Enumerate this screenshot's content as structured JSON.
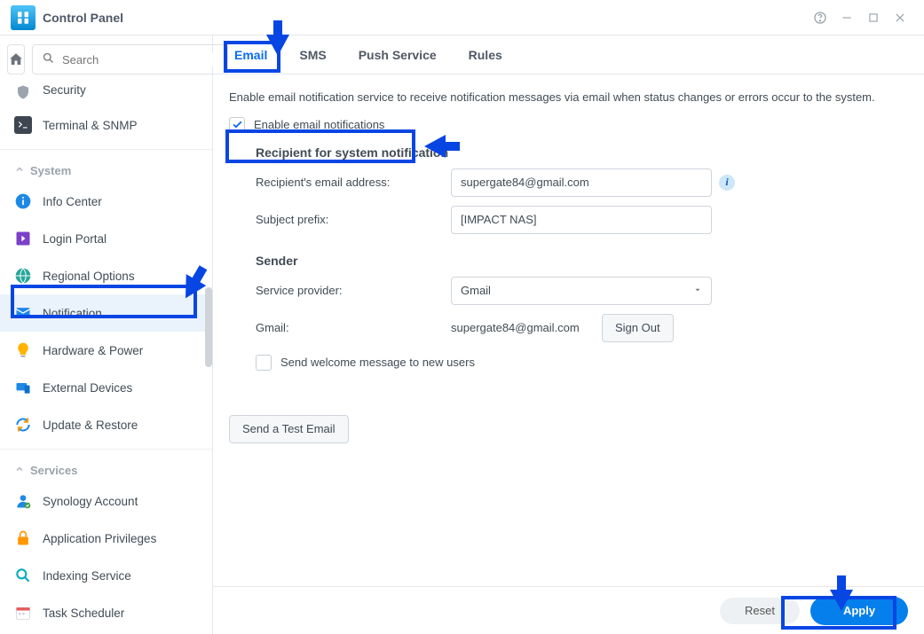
{
  "header": {
    "title": "Control Panel"
  },
  "search": {
    "placeholder": "Search"
  },
  "sidebar": {
    "top_partial": "Security",
    "items_security": [
      {
        "label": "Terminal & SNMP"
      }
    ],
    "section_system": "System",
    "items_system": [
      {
        "label": "Info Center"
      },
      {
        "label": "Login Portal"
      },
      {
        "label": "Regional Options"
      },
      {
        "label": "Notification"
      },
      {
        "label": "Hardware & Power"
      },
      {
        "label": "External Devices"
      },
      {
        "label": "Update & Restore"
      }
    ],
    "section_services": "Services",
    "items_services": [
      {
        "label": "Synology Account"
      },
      {
        "label": "Application Privileges"
      },
      {
        "label": "Indexing Service"
      },
      {
        "label": "Task Scheduler"
      }
    ]
  },
  "tabs": [
    {
      "label": "Email"
    },
    {
      "label": "SMS"
    },
    {
      "label": "Push Service"
    },
    {
      "label": "Rules"
    }
  ],
  "form": {
    "description": "Enable email notification service to receive notification messages via email when status changes or errors occur to the system.",
    "enable_label": "Enable email notifications",
    "recipient_title": "Recipient for system notification",
    "recipient_email_label": "Recipient's email address:",
    "recipient_email_value": "supergate84@gmail.com",
    "subject_prefix_label": "Subject prefix:",
    "subject_prefix_value": "[IMPACT NAS]",
    "sender_title": "Sender",
    "service_provider_label": "Service provider:",
    "service_provider_value": "Gmail",
    "gmail_label": "Gmail:",
    "gmail_value": "supergate84@gmail.com",
    "sign_out": "Sign Out",
    "welcome_label": "Send welcome message to new users",
    "test_button": "Send a Test Email"
  },
  "footer": {
    "reset": "Reset",
    "apply": "Apply"
  }
}
